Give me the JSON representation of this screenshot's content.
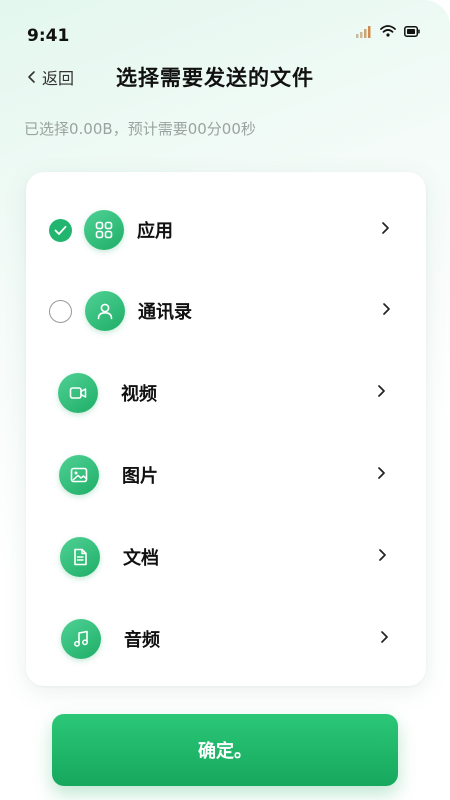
{
  "status_bar": {
    "time": "9:41"
  },
  "header": {
    "back_label": "返回",
    "title": "选择需要发送的文件"
  },
  "selection_info": "已选择0.00B，预计需要00分00秒",
  "categories": [
    {
      "label": "应用",
      "icon": "apps-grid-icon",
      "selected": true
    },
    {
      "label": "通讯录",
      "icon": "contact-person-icon",
      "selected": false
    },
    {
      "label": "视频",
      "icon": "video-camera-icon"
    },
    {
      "label": "图片",
      "icon": "image-icon"
    },
    {
      "label": "文档",
      "icon": "document-icon"
    },
    {
      "label": "音频",
      "icon": "music-note-icon"
    }
  ],
  "confirm_button": {
    "label": "确定。"
  },
  "colors": {
    "accent": "#22b56f",
    "accent_dark": "#16a85d",
    "muted_text": "#9aa3a0"
  }
}
